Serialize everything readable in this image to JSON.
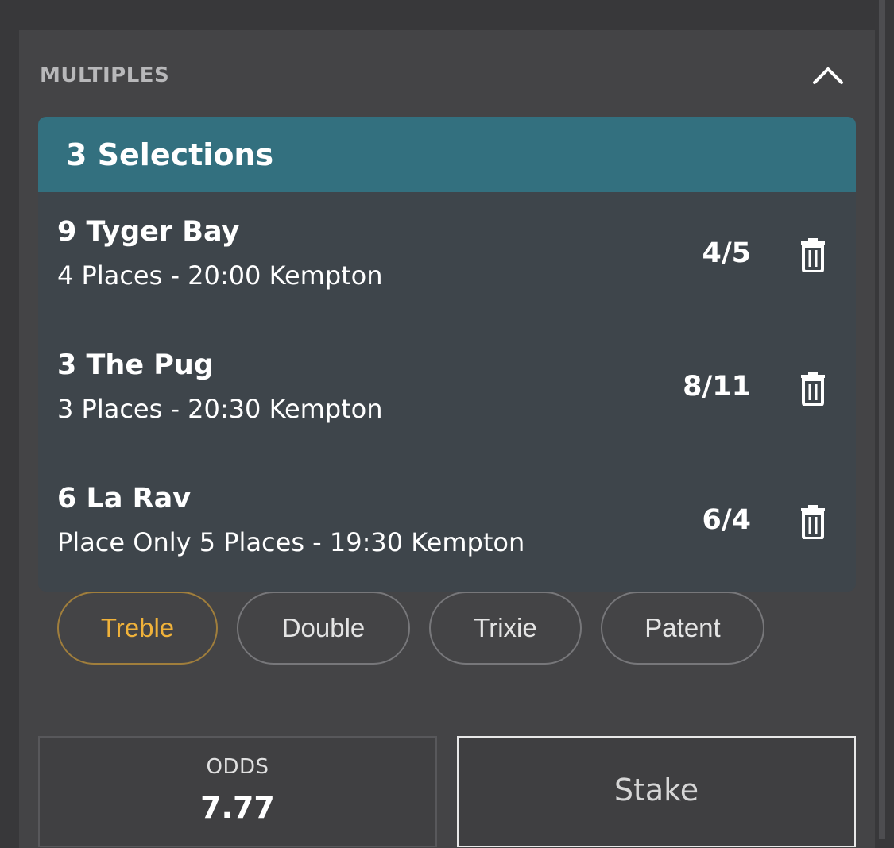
{
  "section": {
    "title": "MULTIPLES",
    "collapse_icon": "chevron-up-icon"
  },
  "card": {
    "title": "3 Selections",
    "header_color": "#33707f",
    "selections": [
      {
        "name": "9 Tyger Bay",
        "desc": "4 Places - 20:00 Kempton",
        "odds": "4/5",
        "icon": "trash-icon"
      },
      {
        "name": "3 The Pug",
        "desc": "3 Places - 20:30 Kempton",
        "odds": "8/11",
        "icon": "trash-icon"
      },
      {
        "name": "6 La Rav",
        "desc": "Place Only 5 Places - 19:30 Kempton",
        "odds": "6/4",
        "icon": "trash-icon"
      }
    ]
  },
  "bet_types": {
    "items": [
      "Treble",
      "Double",
      "Trixie",
      "Patent"
    ],
    "selected": "Treble",
    "accent_color": "#f0b23a"
  },
  "odds": {
    "label": "ODDS",
    "value": "7.77"
  },
  "stake": {
    "placeholder": "Stake"
  }
}
